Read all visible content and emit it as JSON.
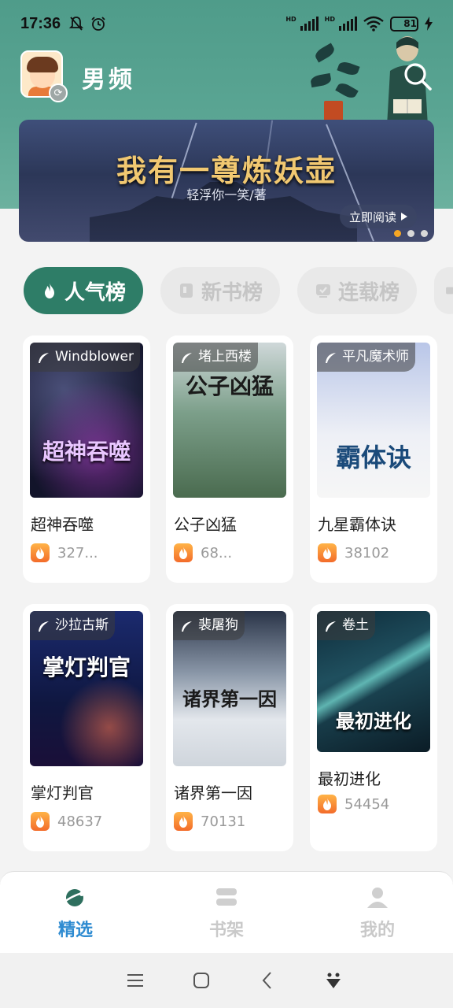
{
  "status_bar": {
    "time": "17:36",
    "battery": "81",
    "battery_level": 0.81,
    "icons": [
      "mute-bell-icon",
      "alarm-icon",
      "signal-hd-icon",
      "signal-hd-icon",
      "wifi-icon",
      "charging-icon"
    ],
    "hd_label": "HD"
  },
  "header": {
    "channel_title": "男频"
  },
  "banner": {
    "title": "我有一尊炼妖壶",
    "author": "轻浮你一笑/著",
    "cta": "立即阅读",
    "dots": 3,
    "active_dot": 0
  },
  "tabs": [
    {
      "label": "人气榜",
      "active": true
    },
    {
      "label": "新书榜",
      "active": false
    },
    {
      "label": "连载榜",
      "active": false
    }
  ],
  "books": [
    {
      "title": "超神吞噬",
      "author": "Windblower",
      "heat": "327...",
      "cover_text": "超神吞噬"
    },
    {
      "title": "公子凶猛",
      "author": "堵上西楼",
      "heat": "68...",
      "cover_text": "公子凶猛"
    },
    {
      "title": "九星霸体诀",
      "author": "平凡魔术师",
      "heat": "38102",
      "cover_text": "霸体诀"
    },
    {
      "title": "掌灯判官",
      "author": "沙拉古斯",
      "heat": "48637",
      "cover_text": "掌灯判官"
    },
    {
      "title": "诸界第一因",
      "author": "裴屠狗",
      "heat": "70131",
      "cover_text": "诸界第一因"
    },
    {
      "title": "最初进化",
      "author": "卷土",
      "heat": "54454",
      "cover_text": "最初进化"
    }
  ],
  "bottom_nav": [
    {
      "label": "精选",
      "icon": "planet-icon",
      "active": true
    },
    {
      "label": "书架",
      "icon": "bookshelf-icon",
      "active": false
    },
    {
      "label": "我的",
      "icon": "user-icon",
      "active": false
    }
  ],
  "colors": {
    "accent": "#2e7d67",
    "nav_active": "#2e8bd1",
    "header_bg": "#5aa593",
    "heat_orange": "#f36b2a"
  }
}
